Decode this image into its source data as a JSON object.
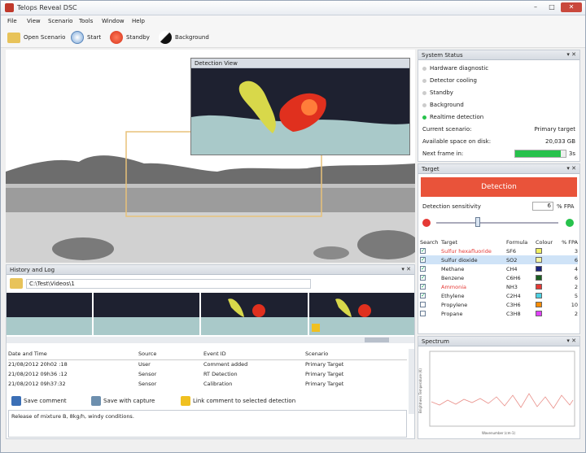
{
  "app": {
    "title": "Telops Reveal DSC"
  },
  "window_controls": [
    "–",
    "□",
    "✕"
  ],
  "menu": [
    "File",
    "View",
    "Scenario",
    "Tools",
    "Window",
    "Help"
  ],
  "toolbar": {
    "open": "Open Scenario",
    "start": "Start",
    "standby": "Standby",
    "background": "Background"
  },
  "detection_view": {
    "title": "Detection View"
  },
  "history": {
    "title": "History and Log",
    "path": "C:\\Test\\Videos\\1",
    "columns": [
      "Date and Time",
      "Source",
      "Event ID",
      "Scenario"
    ],
    "rows": [
      [
        "21/08/2012 20h02 :18",
        "User",
        "Comment added",
        "Primary Target"
      ],
      [
        "21/08/2012 09h36 :12",
        "Sensor",
        "RT Detection",
        "Primary Target"
      ],
      [
        "21/08/2012 09h37:32",
        "Sensor",
        "Calibration",
        "Primary Target"
      ]
    ],
    "buttons": {
      "save_comment": "Save comment",
      "save_capture": "Save with capture",
      "link": "Link comment to selected detection"
    },
    "comment": "Release of mixture B, 8kg/h, windy conditions."
  },
  "system_status": {
    "title": "System Status",
    "items": [
      "Hardware diagnostic",
      "Detector cooling",
      "Standby",
      "Background",
      "Realtime detection"
    ],
    "labels": {
      "scenario": "Current scenario:",
      "space": "Available space on disk:",
      "next": "Next frame in:"
    },
    "values": {
      "scenario": "Primary target",
      "space": "20,033 GB",
      "next": "3s"
    },
    "next_frame_progress": 0.9
  },
  "target": {
    "title": "Target",
    "detection": "Detection",
    "sensitivity_label": "Detection sensitivity",
    "sensitivity_value": "6",
    "sensitivity_unit": "% FPA",
    "columns": [
      "Search",
      "Target",
      "Formula",
      "Colour",
      "% FPA"
    ],
    "rows": [
      {
        "checked": true,
        "name": "Sulfur hexafluoride",
        "formula": "SF6",
        "color": "#f0f060",
        "fpa": "3",
        "alert": true
      },
      {
        "checked": true,
        "name": "Sulfur dioxide",
        "formula": "SO2",
        "color": "#f5f5a0",
        "fpa": "6",
        "alert": false,
        "selected": true
      },
      {
        "checked": true,
        "name": "Methane",
        "formula": "CH4",
        "color": "#1a237e",
        "fpa": "4",
        "alert": false
      },
      {
        "checked": true,
        "name": "Benzene",
        "formula": "C6H6",
        "color": "#1b5e20",
        "fpa": "6",
        "alert": false
      },
      {
        "checked": true,
        "name": "Ammonia",
        "formula": "NH3",
        "color": "#e53935",
        "fpa": "2",
        "alert": true
      },
      {
        "checked": true,
        "name": "Ethylene",
        "formula": "C2H4",
        "color": "#4dd0e1",
        "fpa": "5",
        "alert": false
      },
      {
        "checked": false,
        "name": "Propylene",
        "formula": "C3H6",
        "color": "#fb8c00",
        "fpa": "10",
        "alert": false
      },
      {
        "checked": false,
        "name": "Propane",
        "formula": "C3H8",
        "color": "#e040fb",
        "fpa": "2",
        "alert": false
      }
    ]
  },
  "spectrum": {
    "title": "Spectrum",
    "ylabel": "Brightness Temperature (K)",
    "xlabel": "Wavenumber (cm-1)"
  },
  "colors": {
    "accent": "#e9533a",
    "progress": "#27c24c"
  }
}
